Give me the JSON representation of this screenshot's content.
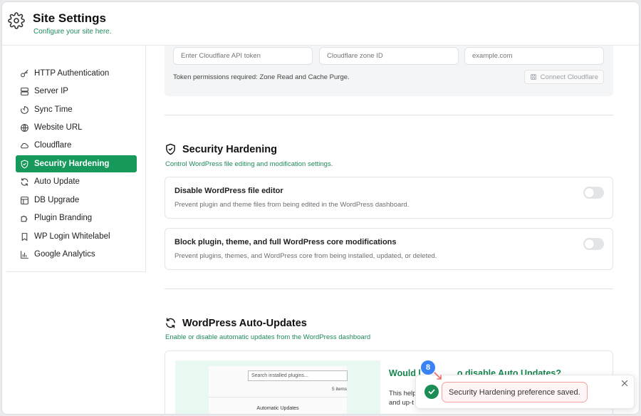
{
  "header": {
    "title": "Site Settings",
    "subtitle": "Configure your site here."
  },
  "sidebar": {
    "items": [
      {
        "label": "HTTP Authentication",
        "icon": "key-icon"
      },
      {
        "label": "Server IP",
        "icon": "server-icon"
      },
      {
        "label": "Sync Time",
        "icon": "timer-icon"
      },
      {
        "label": "Website URL",
        "icon": "globe-icon"
      },
      {
        "label": "Cloudflare",
        "icon": "cloud-icon"
      },
      {
        "label": "Security Hardening",
        "icon": "shield-check-icon",
        "active": true
      },
      {
        "label": "Auto Update",
        "icon": "refresh-icon"
      },
      {
        "label": "DB Upgrade",
        "icon": "database-icon"
      },
      {
        "label": "Plugin Branding",
        "icon": "puzzle-icon"
      },
      {
        "label": "WP Login Whitelabel",
        "icon": "bookmark-icon"
      },
      {
        "label": "Google Analytics",
        "icon": "bar-chart-icon"
      }
    ]
  },
  "cloudflare": {
    "api_token_placeholder": "Enter Cloudflare API token",
    "zone_id_placeholder": "Cloudflare zone ID",
    "domain_placeholder": "example.com",
    "note": "Token permissions required: Zone Read and Cache Purge.",
    "connect_label": "Connect Cloudflare"
  },
  "security": {
    "title": "Security Hardening",
    "subtitle": "Control WordPress file editing and modification settings.",
    "options": [
      {
        "title": "Disable WordPress file editor",
        "description": "Prevent plugin and theme files from being edited in the WordPress dashboard.",
        "enabled": false
      },
      {
        "title": "Block plugin, theme, and full WordPress core modifications",
        "description": "Prevent plugins, themes, and WordPress core from being installed, updated, or deleted.",
        "enabled": false
      }
    ]
  },
  "auto_updates": {
    "title": "WordPress Auto-Updates",
    "subtitle": "Enable or disable automatic updates from the WordPress dashboard",
    "promo_title": "Would l",
    "promo_title_end": "o disable Auto Updates?",
    "promo_text_line1": "This help",
    "promo_text_line2": "and up-t",
    "preview": {
      "search_placeholder": "Search installed plugins...",
      "count": "5 items",
      "column": "Automatic Updates"
    }
  },
  "toast": {
    "message": "Security Hardening preference saved.",
    "step_badge": "8"
  },
  "colors": {
    "accent": "#17995c",
    "accent_text": "#1e8a5a",
    "badge": "#3b82f6",
    "toast_border": "#f3a1a1"
  }
}
